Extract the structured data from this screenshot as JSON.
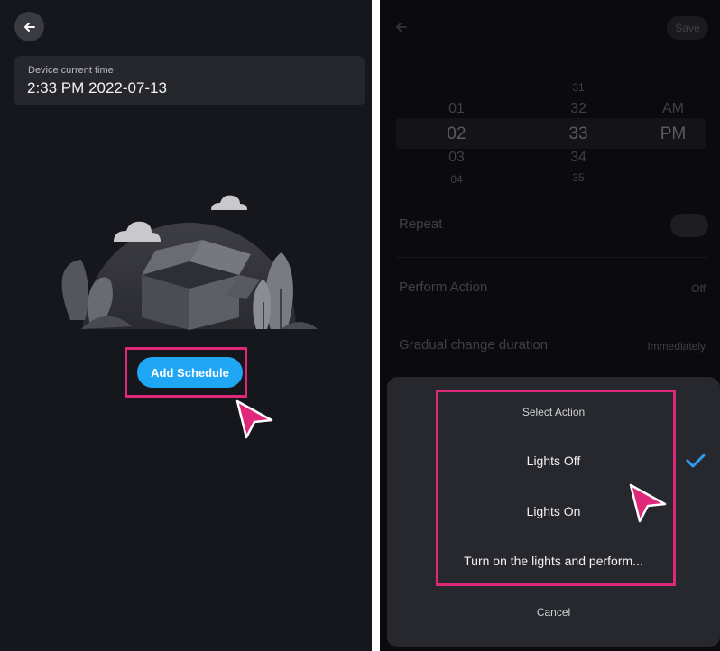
{
  "left_screen": {
    "device_time_label": "Device current time",
    "device_time_value": "2:33 PM 2022-07-13",
    "add_schedule_label": "Add Schedule"
  },
  "right_screen": {
    "save_label": "Save",
    "picker": {
      "hours": [
        "01",
        "02",
        "03",
        "04"
      ],
      "minutes": [
        "31",
        "32",
        "33",
        "34",
        "35"
      ],
      "periods": [
        "AM",
        "PM"
      ],
      "selected": {
        "hour": "02",
        "minute": "33",
        "period": "PM"
      }
    },
    "repeat_label": "Repeat",
    "perform_action_label": "Perform Action",
    "perform_action_value": "Off",
    "gradual_label": "Gradual change duration",
    "gradual_value": "Immediately",
    "sheet": {
      "title": "Select Action",
      "options": [
        "Lights Off",
        "Lights On",
        "Turn on the lights and perform..."
      ],
      "selected_option": "Lights Off",
      "cancel_label": "Cancel"
    }
  },
  "colors": {
    "accent_blue": "#1fa6f5",
    "highlight_pink": "#e0287a",
    "check_blue": "#2e9bf0"
  },
  "icons": [
    "back-arrow-icon",
    "empty-box-illustration",
    "cursor-pointer-icon",
    "checkmark-icon"
  ]
}
